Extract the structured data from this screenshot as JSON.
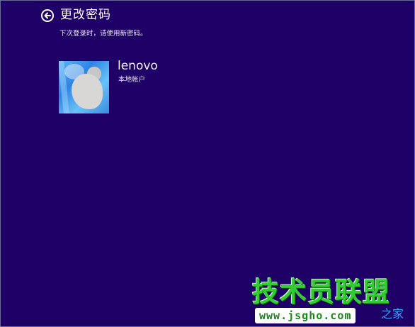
{
  "header": {
    "back_icon": "back-arrow-circle-icon",
    "title": "更改密码",
    "subtitle": "下次登录时，请使用新密码。"
  },
  "account": {
    "name": "lenovo",
    "type": "本地帐户"
  },
  "watermark": {
    "title": "技术员联盟",
    "url": "www.jsgho.com",
    "suffix": "之家"
  },
  "colors": {
    "background": "#1e0066",
    "text": "#ffffff",
    "watermark_green": "#33cc33",
    "watermark_blue": "#3aa0ff"
  }
}
